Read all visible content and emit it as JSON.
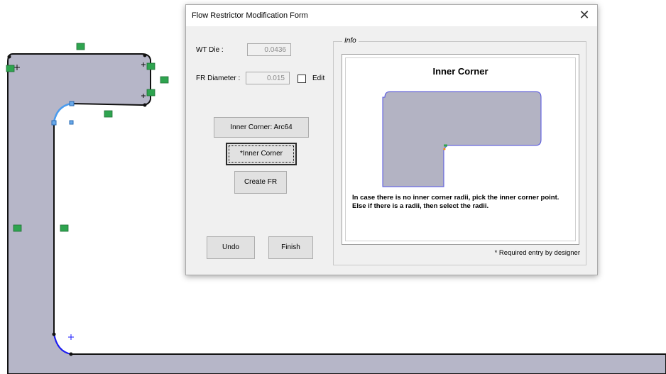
{
  "dialog": {
    "title": "Flow Restrictor Modification Form",
    "close_glyph": "✕",
    "wt_die_label": "WT Die :",
    "wt_die_value": "0.0436",
    "fr_diameter_label": "FR Diameter :",
    "fr_diameter_value": "0.015",
    "edit_label": "Edit",
    "edit_checked": false,
    "inner_corner_arc_button": "Inner Corner: Arc64",
    "inner_corner_button": "*Inner Corner",
    "create_fr_button": "Create FR",
    "undo_button": "Undo",
    "finish_button": "Finish"
  },
  "info": {
    "legend": "Info",
    "heading": "Inner Corner",
    "instruction_line1": "In case there is no inner corner radii, pick the inner corner point.",
    "instruction_line2": "Else if there is a radii, then select the radii.",
    "required_note": "* Required entry by designer"
  },
  "colors": {
    "profile_fill": "#b6b6c8",
    "selected_edge": "#4a9cf0",
    "arc_edge": "#1a1aff",
    "relation_marker": "#2ea44f",
    "diagram_outline": "#4a4ad8"
  }
}
